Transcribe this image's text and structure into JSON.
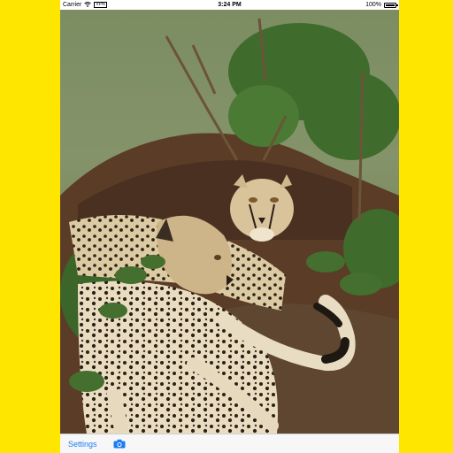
{
  "status_bar": {
    "carrier": "Carrier",
    "time": "3:24 PM",
    "battery": "100%",
    "battery_level": 1.0,
    "wifi_icon": "wifi-icon",
    "battery_icon": "battery-icon"
  },
  "photo": {
    "subject": "cheetahs-photo"
  },
  "toolbar": {
    "settings_label": "Settings",
    "camera_icon": "camera-icon"
  },
  "colors": {
    "background": "#FFE600",
    "accent": "#1A7CF5"
  }
}
